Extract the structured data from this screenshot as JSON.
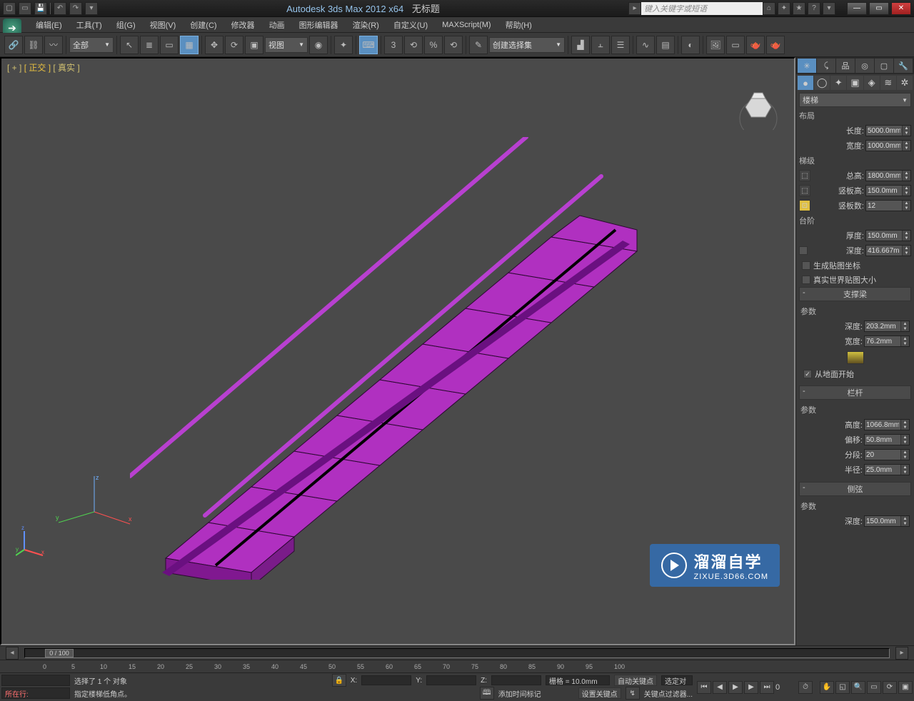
{
  "title": {
    "app": "Autodesk 3ds Max  2012 x64",
    "doc": "无标题"
  },
  "search_placeholder": "键入关键字或短语",
  "menus": [
    "编辑(E)",
    "工具(T)",
    "组(G)",
    "视图(V)",
    "创建(C)",
    "修改器",
    "动画",
    "图形编辑器",
    "渲染(R)",
    "自定义(U)",
    "MAXScript(M)",
    "帮助(H)"
  ],
  "toolbar": {
    "sel_filter": "全部",
    "view_mode": "视图",
    "named_sel": "创建选择集"
  },
  "viewport_label": {
    "prefix": "[ + ]",
    "ortho": "[ 正交 ]",
    "mode": "[ 真实 ]"
  },
  "command_panel": {
    "object_type": "楼梯",
    "layout": {
      "label": "布局",
      "length_lbl": "长度:",
      "length": "5000.0mm",
      "width_lbl": "宽度:",
      "width": "1000.0mm"
    },
    "rise": {
      "label": "梯级",
      "overall_lbl": "总高:",
      "overall": "1800.0mm",
      "riser_h_lbl": "竖板高:",
      "riser_h": "150.0mm",
      "riser_ct_lbl": "竖板数:",
      "riser_ct": "12"
    },
    "step": {
      "label": "台阶",
      "thick_lbl": "厚度:",
      "thick": "150.0mm",
      "depth_lbl": "深度:",
      "depth": "416.667m"
    },
    "gen_map": "生成贴图坐标",
    "real_world": "真实世界贴图大小",
    "carriage": {
      "title": "支撑梁",
      "params": "参数",
      "depth_lbl": "深度:",
      "depth": "203.2mm",
      "width_lbl": "宽度:",
      "width": "76.2mm",
      "from_ground": "从地面开始"
    },
    "rail": {
      "title": "栏杆",
      "params": "参数",
      "height_lbl": "高度:",
      "height": "1066.8mm",
      "offset_lbl": "偏移:",
      "offset": "50.8mm",
      "seg_lbl": "分段:",
      "seg": "20",
      "radius_lbl": "半径:",
      "radius": "25.0mm"
    },
    "stringer": {
      "title": "侧弦",
      "params": "参数",
      "depth_lbl": "深度:",
      "depth": "150.0mm"
    }
  },
  "timeline": {
    "label": "0 / 100",
    "ticks": [
      "0",
      "5",
      "10",
      "15",
      "20",
      "25",
      "30",
      "35",
      "40",
      "45",
      "50",
      "55",
      "60",
      "65",
      "70",
      "75",
      "80",
      "85",
      "90",
      "95",
      "100"
    ]
  },
  "status": {
    "row_label": "所在行:",
    "sel_text": "选择了 1 个 对象",
    "prompt": "指定楼梯低角点。",
    "grid": "栅格 = 10.0mm",
    "add_time_tag": "添加时间标记",
    "autokey": "自动关键点",
    "selkey": "选定对",
    "setkey": "设置关键点",
    "keyfilter": "关键点过滤器..."
  },
  "watermark": {
    "main": "溜溜自学",
    "sub": "ZIXUE.3D66.COM"
  }
}
